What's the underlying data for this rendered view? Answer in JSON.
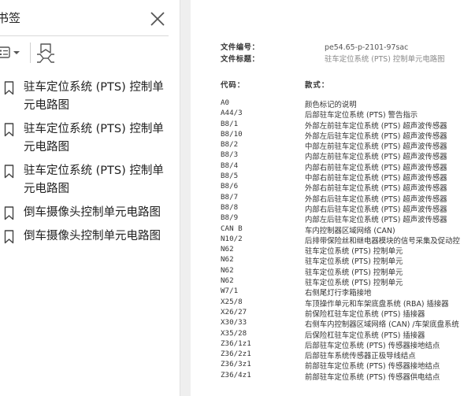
{
  "panel": {
    "title": "书签",
    "close_icon": "close-icon",
    "options_icon": "options-menu-icon",
    "find_icon": "find-bookmark-icon",
    "bookmarks": [
      {
        "label": "驻车定位系统 (PTS) 控制单元电路图"
      },
      {
        "label": "驻车定位系统 (PTS) 控制单元电路图"
      },
      {
        "label": "驻车定位系统 (PTS) 控制单元电路图"
      },
      {
        "label": "倒车摄像头控制单元电路图"
      },
      {
        "label": "倒车摄像头控制单元电路图"
      }
    ]
  },
  "doc": {
    "number_label": "文件编号：",
    "number_value": "pe54.65-p-2101-97sac",
    "title_label": "文件标题：",
    "title_value": "驻车定位系统 (PTS) 控制单元电路图",
    "codes_heading": "代码：",
    "types_heading": "款式：",
    "rows": [
      {
        "code": "A0",
        "desc": "颜色标记的说明"
      },
      {
        "code": "A44/3",
        "desc": "后部驻车定位系统 (PTS) 警告指示"
      },
      {
        "code": "B8/1",
        "desc": "外部左前驻车定位系统 (PTS) 超声波传感器"
      },
      {
        "code": "B8/10",
        "desc": "外部左后驻车定位系统 (PTS) 超声波传感器"
      },
      {
        "code": "B8/2",
        "desc": "中部左前驻车定位系统 (PTS) 超声波传感器"
      },
      {
        "code": "B8/3",
        "desc": "内部左前驻车定位系统 (PTS) 超声波传感器"
      },
      {
        "code": "B8/4",
        "desc": "内部右前驻车定位系统 (PTS) 超声波传感器"
      },
      {
        "code": "B8/5",
        "desc": "中部右前驻车定位系统 (PTS) 超声波传感器"
      },
      {
        "code": "B8/6",
        "desc": "外部右前驻车定位系统 (PTS) 超声波传感器"
      },
      {
        "code": "B8/7",
        "desc": "外部右后驻车定位系统 (PTS) 超声波传感器"
      },
      {
        "code": "B8/8",
        "desc": "内部右后驻车定位系统 (PTS) 超声波传感器"
      },
      {
        "code": "B8/9",
        "desc": "内部左后驻车定位系统 (PTS) 超声波传感器"
      },
      {
        "code": "CAN B",
        "desc": "车内控制器区域网络 (CAN)"
      },
      {
        "code": "N10/2",
        "desc": "后排带保险丝和继电器模块的信号采集及促动控"
      },
      {
        "code": "N62",
        "desc": "驻车定位系统 (PTS) 控制单元"
      },
      {
        "code": "N62",
        "desc": "驻车定位系统 (PTS) 控制单元"
      },
      {
        "code": "N62",
        "desc": "驻车定位系统 (PTS) 控制单元"
      },
      {
        "code": "N62",
        "desc": "驻车定位系统 (PTS) 控制单元"
      },
      {
        "code": "W7/1",
        "desc": "右侧尾灯行李箱接地"
      },
      {
        "code": "X25/8",
        "desc": "车顶操作单元和车架底盘系统 (RBA) 插接器"
      },
      {
        "code": "X26/27",
        "desc": "前保险杠驻车定位系统 (PTS) 插接器"
      },
      {
        "code": "X30/33",
        "desc": "右侧车内控制器区域网络 (CAN) /车架底盘系统"
      },
      {
        "code": "X35/28",
        "desc": "后保险杠驻车定位系统 (PTS) 插接器"
      },
      {
        "code": "Z36/1z1",
        "desc": "后部驻车定位系统 (PTS) 传感器接地结点"
      },
      {
        "code": "Z36/2z1",
        "desc": "后部驻车系统传感器正极导线结点"
      },
      {
        "code": "Z36/3z1",
        "desc": "前部驻车定位系统 (PTS) 传感器接地结点"
      },
      {
        "code": "Z36/4z1",
        "desc": "前部驻车定位系统 (PTS) 传感器供电结点"
      }
    ]
  }
}
